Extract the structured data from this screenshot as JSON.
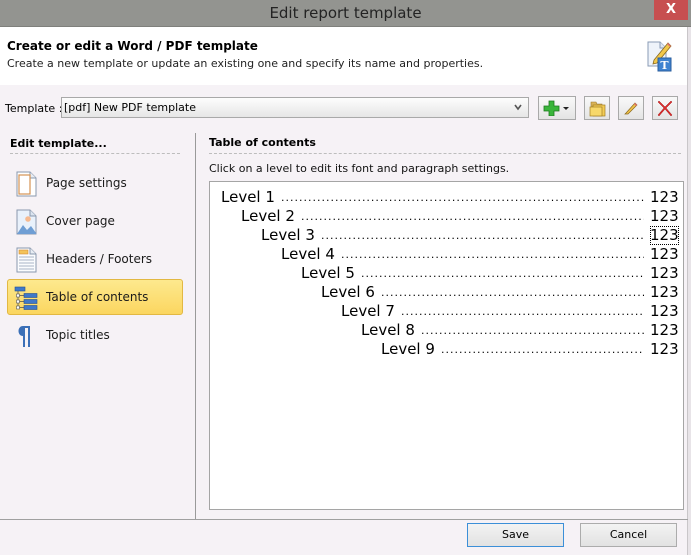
{
  "window": {
    "title": "Edit report template",
    "close_label": "X"
  },
  "header": {
    "title": "Create or edit a Word / PDF template",
    "subtitle": "Create a new template or update an existing one and specify its name and properties.",
    "icon": "edit-template-icon"
  },
  "template_bar": {
    "label": "Template :",
    "selected": "[pdf] New PDF template",
    "buttons": [
      {
        "name": "add-template-button",
        "icon": "green-plus-dropdown-icon"
      },
      {
        "name": "open-template-button",
        "icon": "folder-icon"
      },
      {
        "name": "rename-template-button",
        "icon": "pencil-icon"
      },
      {
        "name": "delete-template-button",
        "icon": "red-x-icon"
      }
    ]
  },
  "sidebar": {
    "heading": "Edit template...",
    "items": [
      {
        "label": "Page settings",
        "icon": "page-icon",
        "selected": false
      },
      {
        "label": "Cover page",
        "icon": "image-page-icon",
        "selected": false
      },
      {
        "label": "Headers / Footers",
        "icon": "header-footer-icon",
        "selected": false
      },
      {
        "label": "Table of contents",
        "icon": "toc-tree-icon",
        "selected": true
      },
      {
        "label": "Topic titles",
        "icon": "pilcrow-icon",
        "selected": false
      }
    ]
  },
  "main": {
    "heading": "Table of contents",
    "hint": "Click on a level to edit its font and paragraph settings.",
    "levels": [
      {
        "label": "Level 1",
        "page": "123"
      },
      {
        "label": "Level 2",
        "page": "123"
      },
      {
        "label": "Level 3",
        "page": "123",
        "focused": true
      },
      {
        "label": "Level 4",
        "page": "123"
      },
      {
        "label": "Level 5",
        "page": "123"
      },
      {
        "label": "Level 6",
        "page": "123"
      },
      {
        "label": "Level 7",
        "page": "123"
      },
      {
        "label": "Level 8",
        "page": "123"
      },
      {
        "label": "Level 9",
        "page": "123"
      }
    ]
  },
  "footer": {
    "save_label": "Save",
    "cancel_label": "Cancel"
  },
  "colors": {
    "titlebar": "#939490",
    "close": "#c74f50",
    "selection": "#fbd660",
    "default_button_border": "#3c8fd8"
  }
}
